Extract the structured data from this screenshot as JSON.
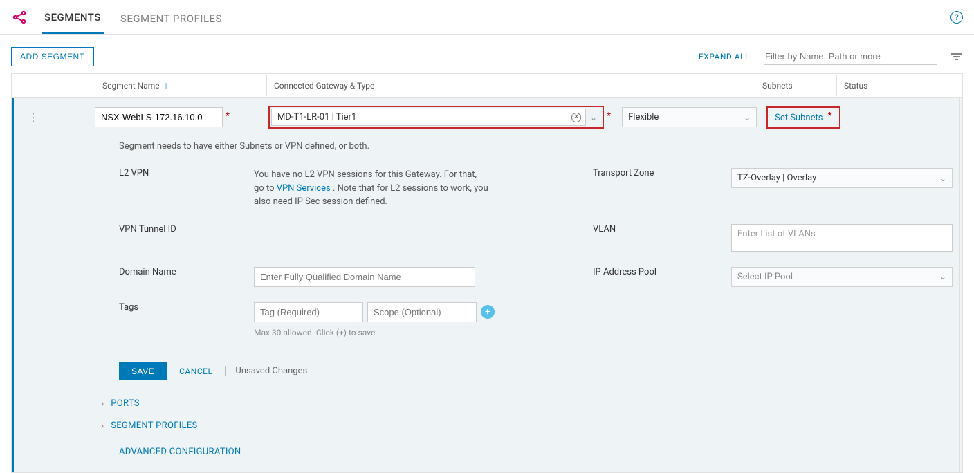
{
  "tabs": {
    "segments": "SEGMENTS",
    "profiles": "SEGMENT PROFILES"
  },
  "actions": {
    "add": "ADD SEGMENT",
    "expand": "EXPAND ALL",
    "search_ph": "Filter by Name, Path or more"
  },
  "columns": {
    "name": "Segment Name",
    "gw": "Connected Gateway & Type",
    "sub": "Subnets",
    "status": "Status"
  },
  "row": {
    "segment_name": "NSX-WebLS-172.16.10.0",
    "gateway": "MD-T1-LR-01 | Tier1",
    "type": "Flexible",
    "set_subnets": "Set Subnets",
    "hint": "Segment needs to have either Subnets or VPN defined, or both.",
    "l2vpn_label": "L2 VPN",
    "l2vpn_text1": "You have no L2 VPN sessions for this Gateway. For that, go to ",
    "l2vpn_link": "VPN Services",
    "l2vpn_text2": " . Note that for L2 sessions to work, you also need IP Sec session defined.",
    "tz_label": "Transport Zone",
    "tz_value": "TZ-Overlay | Overlay",
    "tunnel_label": "VPN Tunnel ID",
    "vlan_label": "VLAN",
    "vlan_ph": "Enter List of VLANs",
    "dn_label": "Domain Name",
    "dn_ph": "Enter Fully Qualified Domain Name",
    "ip_label": "IP Address Pool",
    "ip_ph": "Select IP Pool",
    "tags_label": "Tags",
    "tag_ph": "Tag (Required)",
    "scope_ph": "Scope (Optional)",
    "tag_hint": "Max 30 allowed. Click (+) to save."
  },
  "savebar": {
    "save": "SAVE",
    "cancel": "CANCEL",
    "unsaved": "Unsaved Changes"
  },
  "sections": {
    "ports": "PORTS",
    "profiles": "SEGMENT PROFILES",
    "advanced": "ADVANCED CONFIGURATION"
  }
}
